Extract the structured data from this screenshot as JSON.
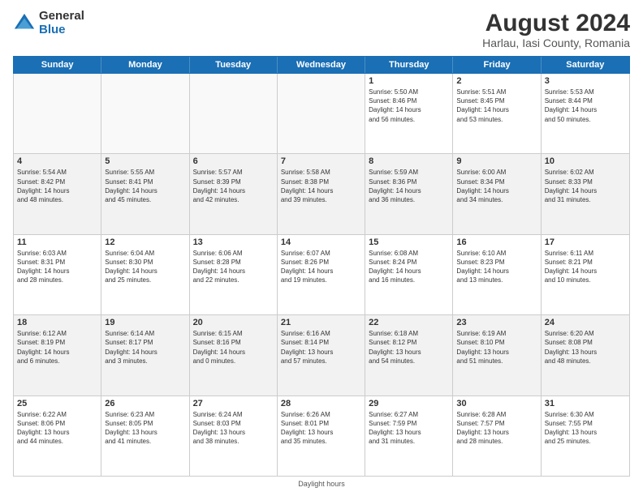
{
  "logo": {
    "general": "General",
    "blue": "Blue"
  },
  "title": "August 2024",
  "subtitle": "Harlau, Iasi County, Romania",
  "weekdays": [
    "Sunday",
    "Monday",
    "Tuesday",
    "Wednesday",
    "Thursday",
    "Friday",
    "Saturday"
  ],
  "footer": "Daylight hours",
  "weeks": [
    [
      {
        "day": "",
        "info": "",
        "empty": true
      },
      {
        "day": "",
        "info": "",
        "empty": true
      },
      {
        "day": "",
        "info": "",
        "empty": true
      },
      {
        "day": "",
        "info": "",
        "empty": true
      },
      {
        "day": "1",
        "info": "Sunrise: 5:50 AM\nSunset: 8:46 PM\nDaylight: 14 hours\nand 56 minutes."
      },
      {
        "day": "2",
        "info": "Sunrise: 5:51 AM\nSunset: 8:45 PM\nDaylight: 14 hours\nand 53 minutes."
      },
      {
        "day": "3",
        "info": "Sunrise: 5:53 AM\nSunset: 8:44 PM\nDaylight: 14 hours\nand 50 minutes."
      }
    ],
    [
      {
        "day": "4",
        "info": "Sunrise: 5:54 AM\nSunset: 8:42 PM\nDaylight: 14 hours\nand 48 minutes."
      },
      {
        "day": "5",
        "info": "Sunrise: 5:55 AM\nSunset: 8:41 PM\nDaylight: 14 hours\nand 45 minutes."
      },
      {
        "day": "6",
        "info": "Sunrise: 5:57 AM\nSunset: 8:39 PM\nDaylight: 14 hours\nand 42 minutes."
      },
      {
        "day": "7",
        "info": "Sunrise: 5:58 AM\nSunset: 8:38 PM\nDaylight: 14 hours\nand 39 minutes."
      },
      {
        "day": "8",
        "info": "Sunrise: 5:59 AM\nSunset: 8:36 PM\nDaylight: 14 hours\nand 36 minutes."
      },
      {
        "day": "9",
        "info": "Sunrise: 6:00 AM\nSunset: 8:34 PM\nDaylight: 14 hours\nand 34 minutes."
      },
      {
        "day": "10",
        "info": "Sunrise: 6:02 AM\nSunset: 8:33 PM\nDaylight: 14 hours\nand 31 minutes."
      }
    ],
    [
      {
        "day": "11",
        "info": "Sunrise: 6:03 AM\nSunset: 8:31 PM\nDaylight: 14 hours\nand 28 minutes."
      },
      {
        "day": "12",
        "info": "Sunrise: 6:04 AM\nSunset: 8:30 PM\nDaylight: 14 hours\nand 25 minutes."
      },
      {
        "day": "13",
        "info": "Sunrise: 6:06 AM\nSunset: 8:28 PM\nDaylight: 14 hours\nand 22 minutes."
      },
      {
        "day": "14",
        "info": "Sunrise: 6:07 AM\nSunset: 8:26 PM\nDaylight: 14 hours\nand 19 minutes."
      },
      {
        "day": "15",
        "info": "Sunrise: 6:08 AM\nSunset: 8:24 PM\nDaylight: 14 hours\nand 16 minutes."
      },
      {
        "day": "16",
        "info": "Sunrise: 6:10 AM\nSunset: 8:23 PM\nDaylight: 14 hours\nand 13 minutes."
      },
      {
        "day": "17",
        "info": "Sunrise: 6:11 AM\nSunset: 8:21 PM\nDaylight: 14 hours\nand 10 minutes."
      }
    ],
    [
      {
        "day": "18",
        "info": "Sunrise: 6:12 AM\nSunset: 8:19 PM\nDaylight: 14 hours\nand 6 minutes."
      },
      {
        "day": "19",
        "info": "Sunrise: 6:14 AM\nSunset: 8:17 PM\nDaylight: 14 hours\nand 3 minutes."
      },
      {
        "day": "20",
        "info": "Sunrise: 6:15 AM\nSunset: 8:16 PM\nDaylight: 14 hours\nand 0 minutes."
      },
      {
        "day": "21",
        "info": "Sunrise: 6:16 AM\nSunset: 8:14 PM\nDaylight: 13 hours\nand 57 minutes."
      },
      {
        "day": "22",
        "info": "Sunrise: 6:18 AM\nSunset: 8:12 PM\nDaylight: 13 hours\nand 54 minutes."
      },
      {
        "day": "23",
        "info": "Sunrise: 6:19 AM\nSunset: 8:10 PM\nDaylight: 13 hours\nand 51 minutes."
      },
      {
        "day": "24",
        "info": "Sunrise: 6:20 AM\nSunset: 8:08 PM\nDaylight: 13 hours\nand 48 minutes."
      }
    ],
    [
      {
        "day": "25",
        "info": "Sunrise: 6:22 AM\nSunset: 8:06 PM\nDaylight: 13 hours\nand 44 minutes."
      },
      {
        "day": "26",
        "info": "Sunrise: 6:23 AM\nSunset: 8:05 PM\nDaylight: 13 hours\nand 41 minutes."
      },
      {
        "day": "27",
        "info": "Sunrise: 6:24 AM\nSunset: 8:03 PM\nDaylight: 13 hours\nand 38 minutes."
      },
      {
        "day": "28",
        "info": "Sunrise: 6:26 AM\nSunset: 8:01 PM\nDaylight: 13 hours\nand 35 minutes."
      },
      {
        "day": "29",
        "info": "Sunrise: 6:27 AM\nSunset: 7:59 PM\nDaylight: 13 hours\nand 31 minutes."
      },
      {
        "day": "30",
        "info": "Sunrise: 6:28 AM\nSunset: 7:57 PM\nDaylight: 13 hours\nand 28 minutes."
      },
      {
        "day": "31",
        "info": "Sunrise: 6:30 AM\nSunset: 7:55 PM\nDaylight: 13 hours\nand 25 minutes."
      }
    ]
  ]
}
